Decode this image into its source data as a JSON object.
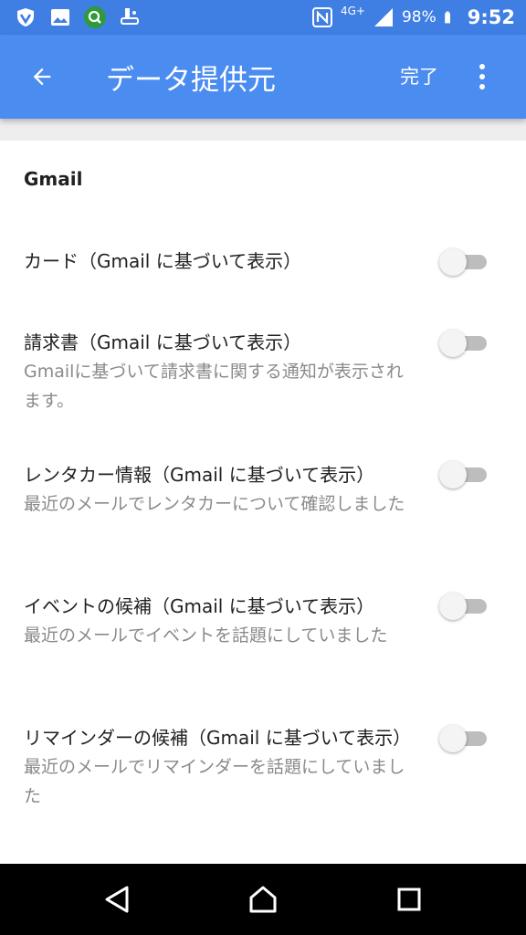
{
  "status_bar": {
    "network": "4G+",
    "battery": "98%",
    "time": "9:52"
  },
  "app_bar": {
    "title": "データ提供元",
    "done_label": "完了"
  },
  "section": {
    "title": "Gmail"
  },
  "preferences": [
    {
      "title": "カード（Gmail に基づいて表示）",
      "summary": "",
      "enabled": false
    },
    {
      "title": "請求書（Gmail に基づいて表示）",
      "summary": "Gmailに基づいて請求書に関する通知が表示されます。",
      "enabled": false
    },
    {
      "title": "レンタカー情報（Gmail に基づいて表示）",
      "summary": "最近のメールでレンタカーについて確認しました",
      "enabled": false
    },
    {
      "title": "イベントの候補（Gmail に基づいて表示）",
      "summary": "最近のメールでイベントを話題にしていました",
      "enabled": false
    },
    {
      "title": "リマインダーの候補（Gmail に基づいて表示）",
      "summary": "最近のメールでリマインダーを話題にしていました",
      "enabled": false
    }
  ],
  "colors": {
    "status_bar": "#3f7ee3",
    "app_bar": "#4b8cf0",
    "switch_off_track": "#bdbdbd",
    "switch_off_thumb": "#f4f4f4"
  }
}
